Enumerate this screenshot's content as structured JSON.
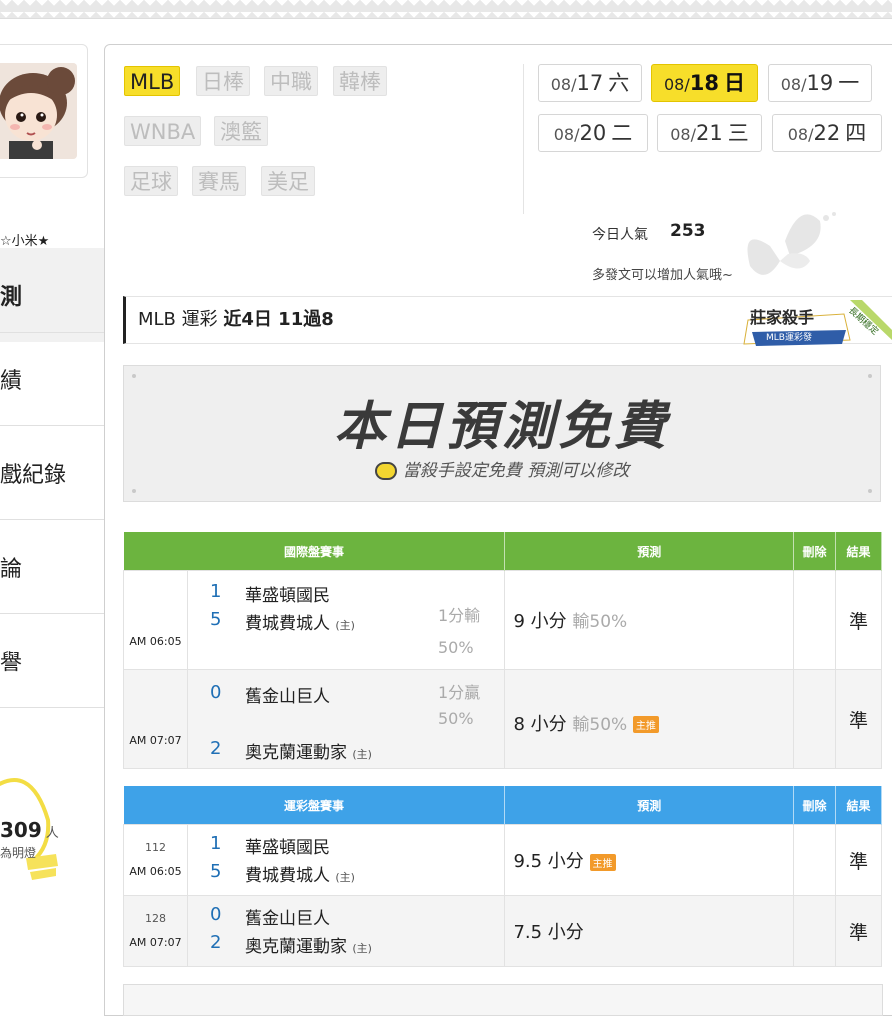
{
  "user": {
    "name": "☆小米★"
  },
  "menu": [
    {
      "label": "測",
      "active": true
    },
    {
      "label": "績",
      "active": false
    },
    {
      "label": "戲紀錄",
      "active": false
    },
    {
      "label": "論",
      "active": false
    },
    {
      "label": "譽",
      "active": false
    }
  ],
  "bulb": {
    "count": "309",
    "unit": "人",
    "sub": "為明燈"
  },
  "leagues": [
    "MLB",
    "日棒",
    "中職",
    "韓棒",
    "WNBA",
    "澳籃",
    "足球",
    "賽馬",
    "美足"
  ],
  "active_league": "MLB",
  "dates": [
    {
      "md": "08/",
      "d": "17",
      "w": "六"
    },
    {
      "md": "08/",
      "d": "18",
      "w": "日"
    },
    {
      "md": "08/",
      "d": "19",
      "w": "一"
    },
    {
      "md": "08/",
      "d": "20",
      "w": "二"
    },
    {
      "md": "08/",
      "d": "21",
      "w": "三"
    },
    {
      "md": "08/",
      "d": "22",
      "w": "四"
    }
  ],
  "active_date": "18",
  "popularity": {
    "label": "今日人氣",
    "value": "253",
    "note": "多發文可以增加人氣哦~"
  },
  "record": {
    "league": "MLB",
    "type": "運彩",
    "summary": "近4日 11過8"
  },
  "badge": {
    "title": "莊家殺手",
    "sub": "MLB運彩發",
    "ribbon": "長期穩定"
  },
  "banner": {
    "title": "本日預測免費",
    "sub": "當殺手設定免費 預測可以修改"
  },
  "intl_table": {
    "headers": [
      "國際盤賽事",
      "預測",
      "刪除",
      "結果"
    ],
    "rows": [
      {
        "time": "AM 06:05",
        "team1_num": "1",
        "team1": "華盛頓國民",
        "team2_num": "5",
        "team2": "費城費城人",
        "host": "(主)",
        "odds1": "1分輸",
        "odds2": "50%",
        "pred": "9 小分",
        "pred_sub": "輸50%",
        "main_tag": "",
        "result": "準"
      },
      {
        "time": "AM 07:07",
        "team1_num": "0",
        "team1": "舊金山巨人",
        "team2_num": "2",
        "team2": "奧克蘭運動家",
        "host": "(主)",
        "odds1": "1分贏",
        "odds2": "50%",
        "pred": "8 小分",
        "pred_sub": "輸50%",
        "main_tag": "主推",
        "result": "準"
      }
    ]
  },
  "sport_table": {
    "headers": [
      "運彩盤賽事",
      "預測",
      "刪除",
      "結果"
    ],
    "rows": [
      {
        "num": "112",
        "time": "AM 06:05",
        "team1_num": "1",
        "team1": "華盛頓國民",
        "team2_num": "5",
        "team2": "費城費城人",
        "host": "(主)",
        "pred": "9.5 小分",
        "main_tag": "主推",
        "result": "準"
      },
      {
        "num": "128",
        "time": "AM 07:07",
        "team1_num": "0",
        "team1": "舊金山巨人",
        "team2_num": "2",
        "team2": "奧克蘭運動家",
        "host": "(主)",
        "pred": "7.5 小分",
        "main_tag": "",
        "result": "準"
      }
    ]
  },
  "colors": {
    "accent_yellow": "#f7de2a",
    "green_header": "#6cb43f",
    "blue_header": "#3ea2e8",
    "result_green": "#2fa02f",
    "tag_orange": "#f29a2a"
  }
}
